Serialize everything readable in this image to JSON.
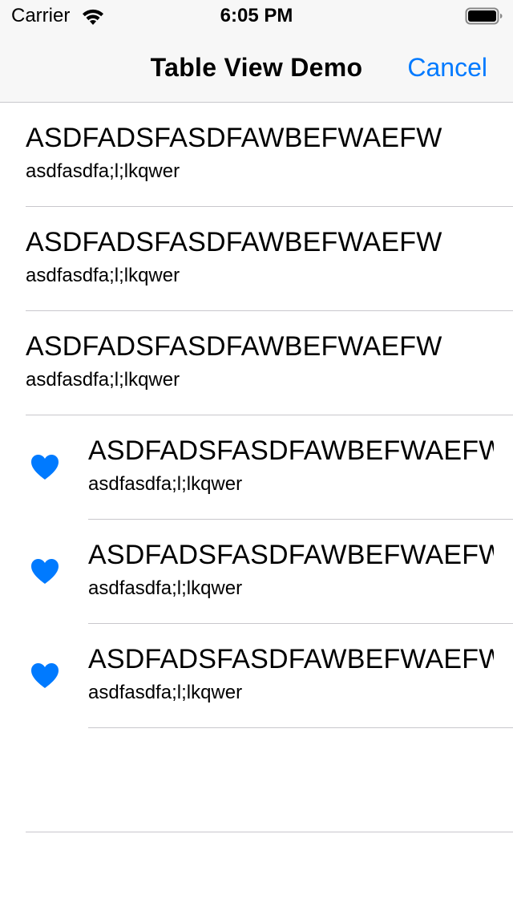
{
  "status_bar": {
    "carrier": "Carrier",
    "time": "6:05 PM",
    "wifi_icon": "wifi-icon",
    "battery_icon": "battery-icon"
  },
  "nav_bar": {
    "title": "Table View Demo",
    "cancel_label": "Cancel"
  },
  "colors": {
    "accent": "#007aff",
    "nav_background": "#f7f7f7",
    "separator": "#c8c7cc"
  },
  "table": {
    "rows": [
      {
        "title": "ASDFADSFASDFAWBEFWAEFW",
        "subtitle": "asdfasdfa;l;lkqwer",
        "icon": ""
      },
      {
        "title": "ASDFADSFASDFAWBEFWAEFW",
        "subtitle": "asdfasdfa;l;lkqwer",
        "icon": ""
      },
      {
        "title": "ASDFADSFASDFAWBEFWAEFW",
        "subtitle": "asdfasdfa;l;lkqwer",
        "icon": ""
      },
      {
        "title": "ASDFADSFASDFAWBEFWAEFW",
        "subtitle": "asdfasdfa;l;lkqwer",
        "icon": "heart-icon"
      },
      {
        "title": "ASDFADSFASDFAWBEFWAEFW",
        "subtitle": "asdfasdfa;l;lkqwer",
        "icon": "heart-icon"
      },
      {
        "title": "ASDFADSFASDFAWBEFWAEFW",
        "subtitle": "asdfasdfa;l;lkqwer",
        "icon": "heart-icon"
      }
    ]
  }
}
